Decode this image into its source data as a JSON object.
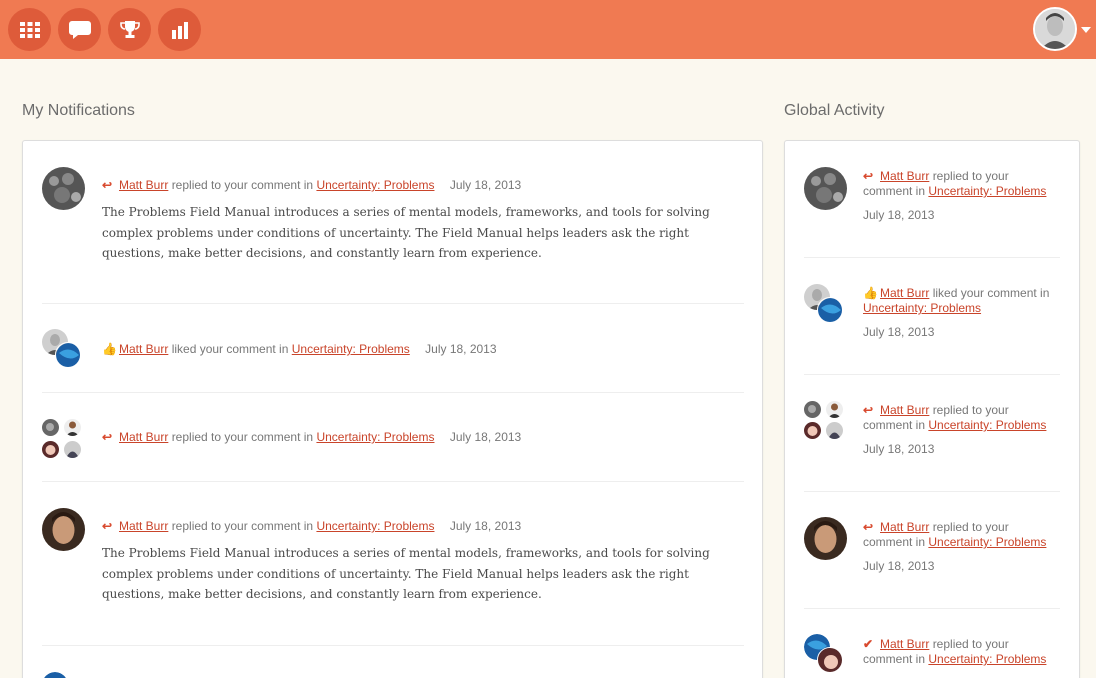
{
  "topbar": {
    "nav": [
      {
        "icon": "grid-icon"
      },
      {
        "icon": "chat-bubble-icon"
      },
      {
        "icon": "trophy-icon"
      },
      {
        "icon": "bar-chart-icon"
      }
    ],
    "accent": "#f07a52",
    "button_color": "#de5b3a"
  },
  "left": {
    "title": "My Notifications",
    "items": [
      {
        "icon": "reply-icon",
        "user": "Matt Burr",
        "action": "replied to your comment in",
        "link": "Uncertainty: Problems",
        "date": "July 18, 2013",
        "body": "The Problems Field Manual introduces a series of mental models, frameworks, and tools for solving complex problems under conditions of uncertainty. The Field Manual helps leaders ask the right questions, make better decisions, and constantly learn from experience."
      },
      {
        "icon": "thumbs-up-icon",
        "user": "Matt Burr",
        "action": "liked your comment in",
        "link": "Uncertainty: Problems",
        "date": "July 18, 2013"
      },
      {
        "icon": "reply-icon",
        "user": "Matt Burr",
        "action": "replied to your comment in",
        "link": "Uncertainty: Problems",
        "date": "July 18, 2013"
      },
      {
        "icon": "reply-icon",
        "user": "Matt Burr",
        "action": "replied to your comment in",
        "link": "Uncertainty: Problems",
        "date": "July 18, 2013",
        "body": "The Problems Field Manual introduces a series of mental models, frameworks, and tools for solving complex problems under conditions of uncertainty. The Field Manual helps leaders ask the right questions, make better decisions, and constantly learn from experience."
      }
    ]
  },
  "right": {
    "title": "Global Activity",
    "items": [
      {
        "icon": "reply-icon",
        "user": "Matt Burr",
        "action": "replied to your",
        "action2": "comment in",
        "link": "Uncertainty: Problems",
        "date": "July 18, 2013"
      },
      {
        "icon": "thumbs-up-icon",
        "user": "Matt Burr",
        "action": "liked your comment in",
        "link": "Uncertainty: Problems",
        "date": "July 18, 2013"
      },
      {
        "icon": "reply-icon",
        "user": "Matt Burr",
        "action": "replied to your",
        "action2": "comment in",
        "link": "Uncertainty: Problems",
        "date": "July 18, 2013"
      },
      {
        "icon": "reply-icon",
        "user": "Matt Burr",
        "action": "replied to your",
        "action2": "comment in",
        "link": "Uncertainty: Problems",
        "date": "July 18, 2013"
      },
      {
        "icon": "checkmark-icon",
        "user": "Matt Burr",
        "action": "replied to your",
        "action2": "comment in",
        "link": "Uncertainty: Problems"
      }
    ]
  }
}
